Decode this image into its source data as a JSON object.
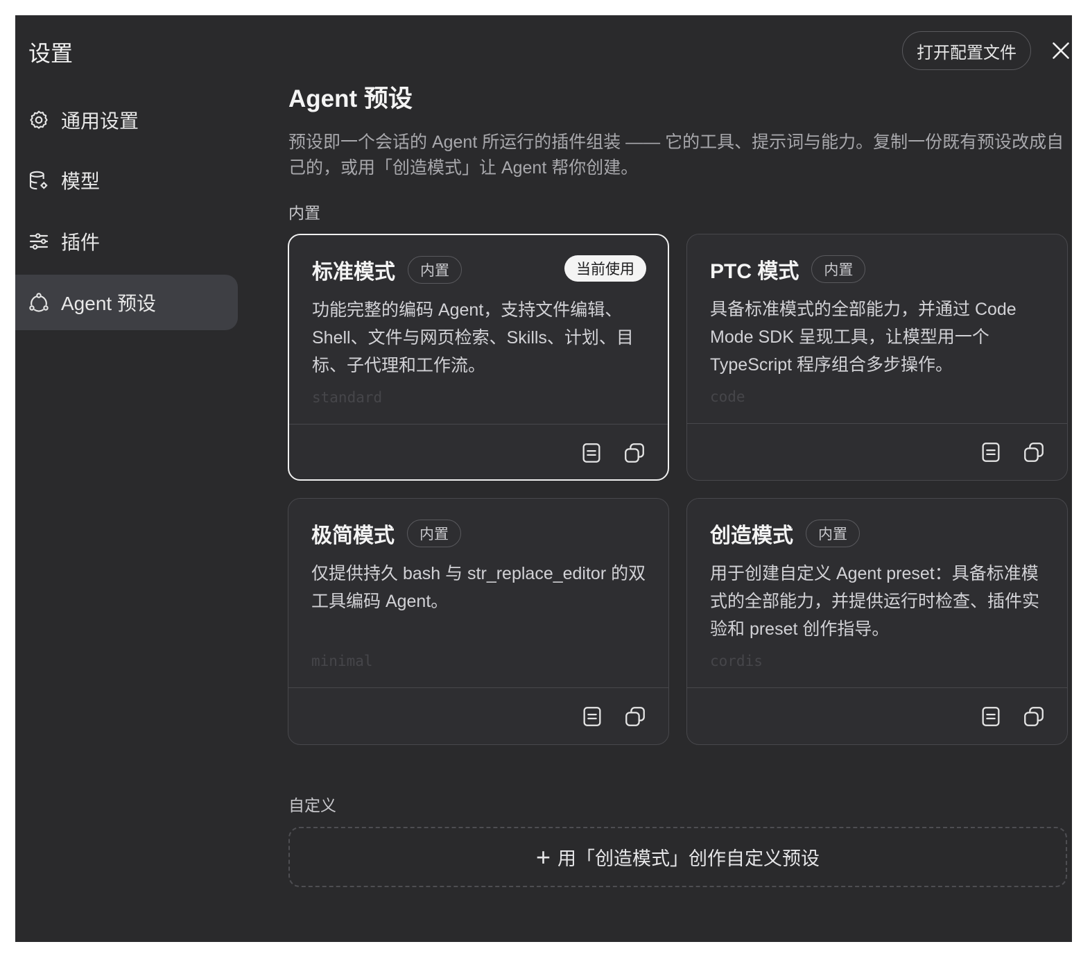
{
  "sidebar": {
    "title": "设置",
    "items": [
      {
        "label": "通用设置",
        "icon": "gear-icon"
      },
      {
        "label": "模型",
        "icon": "database-icon"
      },
      {
        "label": "插件",
        "icon": "sliders-icon"
      },
      {
        "label": "Agent 预设",
        "icon": "agent-icon",
        "active": true
      }
    ]
  },
  "header": {
    "open_config_label": "打开配置文件",
    "close_icon": "close-icon"
  },
  "main": {
    "title": "Agent 预设",
    "description": "预设即一个会话的 Agent 所运行的插件组装 —— 它的工具、提示词与能力。复制一份既有预设改成自己的，或用「创造模式」让 Agent 帮你创建。",
    "builtin_label": "内置",
    "custom_label": "自定义",
    "presets": [
      {
        "name": "标准模式",
        "tag": "内置",
        "current_badge": "当前使用",
        "description": "功能完整的编码 Agent，支持文件编辑、Shell、文件与网页检索、Skills、计划、目标、子代理和工作流。",
        "id": "standard"
      },
      {
        "name": "PTC 模式",
        "tag": "内置",
        "description": "具备标准模式的全部能力，并通过 Code Mode SDK 呈现工具，让模型用一个 TypeScript 程序组合多步操作。",
        "id": "code"
      },
      {
        "name": "极简模式",
        "tag": "内置",
        "description": "仅提供持久 bash 与 str_replace_editor 的双工具编码 Agent。",
        "id": "minimal"
      },
      {
        "name": "创造模式",
        "tag": "内置",
        "description": "用于创建自定义 Agent preset：具备标准模式的全部能力，并提供运行时检查、插件实验和 preset 创作指导。",
        "id": "cordis"
      }
    ],
    "create_button": {
      "plus": "+",
      "label": "用「创造模式」创作自定义预设"
    }
  },
  "colors": {
    "background": "#2a2a2c",
    "card": "#2e2e31",
    "active_nav": "#3e3f44",
    "text": "#f4f4f4"
  }
}
